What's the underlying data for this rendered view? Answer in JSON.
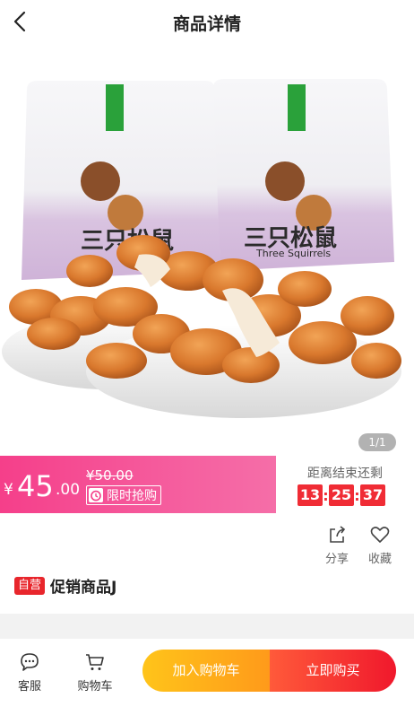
{
  "header": {
    "title": "商品详情",
    "back_icon": "chevron-left-icon"
  },
  "hero": {
    "brand_cn": "三只松鼠",
    "brand_en": "Three Squirrels",
    "image_counter": "1/1"
  },
  "price": {
    "currency": "¥",
    "integer": "45",
    "decimal": ".00",
    "original": "¥50.00",
    "flash_label": "限时抢购",
    "accent_color": "#f53f8a"
  },
  "countdown": {
    "label": "距离结束还剩",
    "hours": "13",
    "minutes": "25",
    "seconds": "37",
    "separator": ":"
  },
  "actions": {
    "share_label": "分享",
    "favorite_label": "收藏"
  },
  "product": {
    "badge": "自营",
    "name": "促销商品J"
  },
  "bottom_bar": {
    "service_label": "客服",
    "cart_label": "购物车",
    "add_to_cart": "加入购物车",
    "buy_now": "立即购买"
  }
}
